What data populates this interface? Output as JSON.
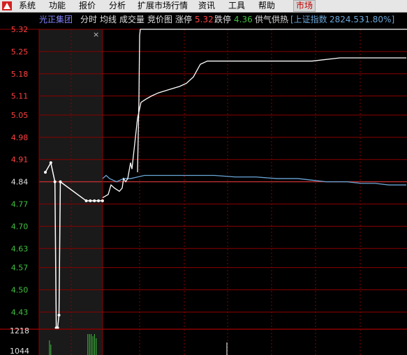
{
  "menu": {
    "items": [
      "系统",
      "功能",
      "报价",
      "分析",
      "扩展市场行情",
      "资讯",
      "工具",
      "帮助",
      "市场"
    ],
    "active_index": 8
  },
  "header": {
    "stock_name": "光正集团",
    "tabs": [
      "分时",
      "均线",
      "成交量",
      "竞价图"
    ],
    "limit_up_label": "涨停",
    "limit_up_value": "5.32",
    "limit_down_label": "跌停",
    "limit_down_value": "4.36",
    "supply_demand": "供气供热",
    "index_name": "[上证指数",
    "index_value": "2824.53",
    "index_change": "-1.80%]"
  },
  "auction_panel": {
    "close_label": "×"
  },
  "colors": {
    "grid_red": "#8b0000",
    "price_up": "#ff4040",
    "price_down": "#40c040",
    "price_line": "#ffffff",
    "avg_line": "#6aa6d8",
    "prev_close_line": "#c03030"
  },
  "chart_data": {
    "type": "line",
    "title": "",
    "y_ticks": [
      {
        "label": "5.32",
        "value": 5.32,
        "dir": "up"
      },
      {
        "label": "5.25",
        "value": 5.25,
        "dir": "up"
      },
      {
        "label": "5.18",
        "value": 5.18,
        "dir": "up"
      },
      {
        "label": "5.11",
        "value": 5.11,
        "dir": "up"
      },
      {
        "label": "5.05",
        "value": 5.05,
        "dir": "up"
      },
      {
        "label": "4.98",
        "value": 4.98,
        "dir": "up"
      },
      {
        "label": "4.91",
        "value": 4.91,
        "dir": "up"
      },
      {
        "label": "4.84",
        "value": 4.84,
        "dir": "flat"
      },
      {
        "label": "4.77",
        "value": 4.77,
        "dir": "down"
      },
      {
        "label": "4.70",
        "value": 4.7,
        "dir": "down"
      },
      {
        "label": "4.63",
        "value": 4.63,
        "dir": "down"
      },
      {
        "label": "4.57",
        "value": 4.57,
        "dir": "down"
      },
      {
        "label": "4.50",
        "value": 4.5,
        "dir": "down"
      },
      {
        "label": "4.43",
        "value": 4.43,
        "dir": "down"
      }
    ],
    "ylim": [
      4.4,
      5.32
    ],
    "prev_close": 4.84,
    "auction_series": {
      "name": "竞价",
      "points": [
        [
          0,
          4.87
        ],
        [
          4,
          4.9
        ],
        [
          7,
          4.84
        ],
        [
          8,
          4.38
        ],
        [
          9,
          4.38
        ],
        [
          10,
          4.42
        ],
        [
          11,
          4.84
        ],
        [
          30,
          4.78
        ],
        [
          33,
          4.78
        ],
        [
          36,
          4.78
        ],
        [
          39,
          4.78
        ],
        [
          42,
          4.78
        ]
      ]
    },
    "price_series": {
      "name": "价格",
      "points": [
        [
          0,
          4.79
        ],
        [
          8,
          4.8
        ],
        [
          12,
          4.83
        ],
        [
          17,
          4.82
        ],
        [
          24,
          4.81
        ],
        [
          28,
          4.82
        ],
        [
          30,
          4.85
        ],
        [
          33,
          4.84
        ],
        [
          36,
          4.85
        ],
        [
          40,
          4.9
        ],
        [
          42,
          4.88
        ],
        [
          46,
          4.96
        ],
        [
          50,
          5.04
        ],
        [
          55,
          5.09
        ],
        [
          62,
          5.1
        ],
        [
          70,
          5.11
        ],
        [
          80,
          5.12
        ],
        [
          95,
          5.13
        ],
        [
          110,
          5.14
        ],
        [
          120,
          5.15
        ],
        [
          130,
          5.17
        ],
        [
          135,
          5.19
        ],
        [
          140,
          5.21
        ],
        [
          150,
          5.22
        ],
        [
          200,
          5.22
        ],
        [
          300,
          5.22
        ],
        [
          340,
          5.23
        ],
        [
          435,
          5.23
        ]
      ]
    },
    "price_limit_spike": {
      "name": "价格",
      "points": [
        [
          50,
          4.87
        ],
        [
          52,
          5.1
        ],
        [
          53,
          5.3
        ],
        [
          54,
          5.32
        ],
        [
          55,
          5.32
        ]
      ]
    },
    "avg_series": {
      "name": "均价",
      "points": [
        [
          0,
          4.85
        ],
        [
          5,
          4.86
        ],
        [
          10,
          4.85
        ],
        [
          20,
          4.84
        ],
        [
          30,
          4.85
        ],
        [
          40,
          4.85
        ],
        [
          60,
          4.86
        ],
        [
          80,
          4.86
        ],
        [
          100,
          4.86
        ],
        [
          130,
          4.86
        ],
        [
          160,
          4.86
        ],
        [
          190,
          4.855
        ],
        [
          220,
          4.855
        ],
        [
          250,
          4.85
        ],
        [
          280,
          4.85
        ],
        [
          300,
          4.845
        ],
        [
          320,
          4.84
        ],
        [
          350,
          4.84
        ],
        [
          370,
          4.835
        ],
        [
          390,
          4.835
        ],
        [
          410,
          4.83
        ],
        [
          435,
          4.83
        ]
      ]
    },
    "volume_label": "1218",
    "volume_label2": "1044",
    "volume_bars": [
      {
        "x": 3,
        "h": 0.7,
        "color": "down"
      },
      {
        "x": 4,
        "h": 0.5,
        "color": "down"
      },
      {
        "x": 54,
        "h": 1.0,
        "color": "down"
      },
      {
        "x": 56,
        "h": 1.0,
        "color": "down"
      },
      {
        "x": 58,
        "h": 1.0,
        "color": "down"
      },
      {
        "x": 60,
        "h": 0.9,
        "color": "down"
      },
      {
        "x": 62,
        "h": 1.0,
        "color": "down"
      },
      {
        "x": 64,
        "h": 0.8,
        "color": "down"
      },
      {
        "x": 190,
        "h": 0.6,
        "color": "white"
      }
    ]
  }
}
